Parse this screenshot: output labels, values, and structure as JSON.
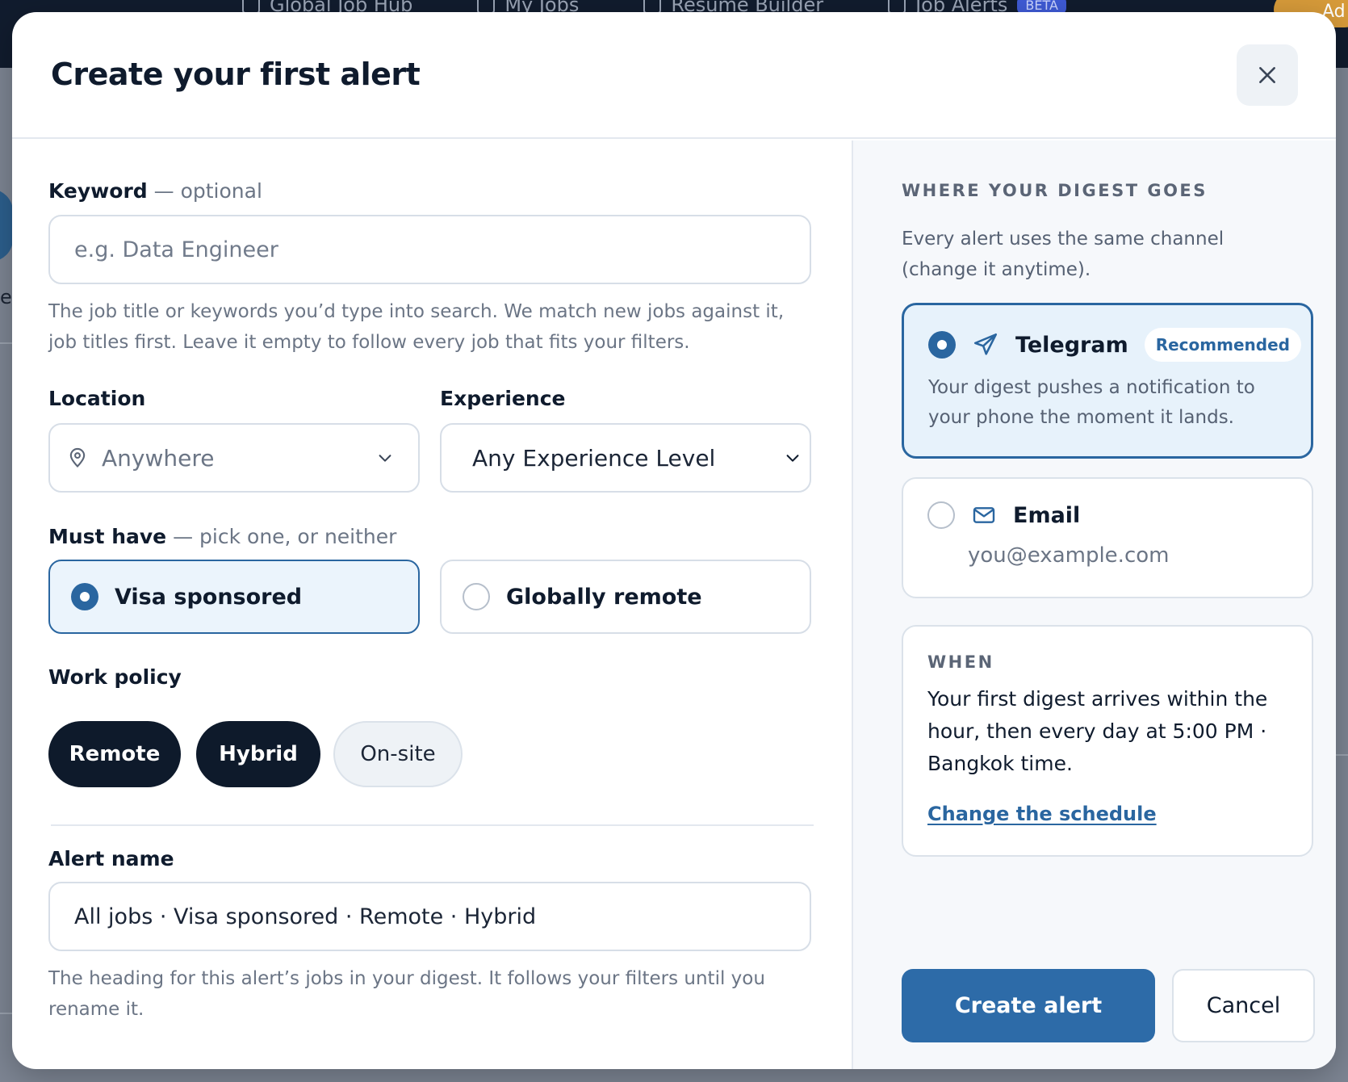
{
  "background": {
    "nav_items": [
      "Global Job Hub",
      "My Jobs",
      "Resume Builder",
      "Job Alerts"
    ],
    "nav_badge": "BETA",
    "cta_label": "Ad",
    "partial_text": "er"
  },
  "modal": {
    "title": "Create your first alert",
    "close_icon": "close-icon"
  },
  "keyword": {
    "label": "Keyword",
    "label_suffix": " — optional",
    "placeholder": "e.g. Data Engineer",
    "value": "",
    "helper": "The job title or keywords you’d type into search. We match new jobs against it, job titles first. Leave it empty to follow every job that fits your filters."
  },
  "location": {
    "label": "Location",
    "value": "Anywhere",
    "icon": "location-pin-icon"
  },
  "experience": {
    "label": "Experience",
    "value": "Any Experience Level"
  },
  "must_have": {
    "label": "Must have",
    "label_suffix": " — pick one, or neither",
    "options": [
      {
        "label": "Visa sponsored",
        "selected": true
      },
      {
        "label": "Globally remote",
        "selected": false
      }
    ]
  },
  "work_policy": {
    "label": "Work policy",
    "options": [
      {
        "label": "Remote",
        "selected": true
      },
      {
        "label": "Hybrid",
        "selected": true
      },
      {
        "label": "On-site",
        "selected": false
      }
    ]
  },
  "alert_name": {
    "label": "Alert name",
    "value": "All jobs · Visa sponsored · Remote · Hybrid",
    "helper": "The heading for this alert’s jobs in your digest. It follows your filters until you rename it."
  },
  "digest": {
    "heading": "WHERE YOUR DIGEST GOES",
    "intro": "Every alert uses the same channel (change it anytime).",
    "channels": [
      {
        "name": "Telegram",
        "icon": "send-icon",
        "badge": "Recommended",
        "description": "Your digest pushes a notification to your phone the moment it lands.",
        "selected": true
      },
      {
        "name": "Email",
        "icon": "mail-icon",
        "value": "you@example.com",
        "selected": false
      }
    ]
  },
  "when": {
    "heading": "WHEN",
    "text": "Your first digest arrives within the hour, then every day at 5:00 PM · Bangkok time.",
    "link": "Change the schedule"
  },
  "actions": {
    "primary": "Create alert",
    "secondary": "Cancel"
  },
  "colors": {
    "accent": "#2a66a0",
    "selected_bg": "#ebf4fc",
    "chip_on": "#0e1a2b",
    "primary_button": "#2d6ba8"
  }
}
